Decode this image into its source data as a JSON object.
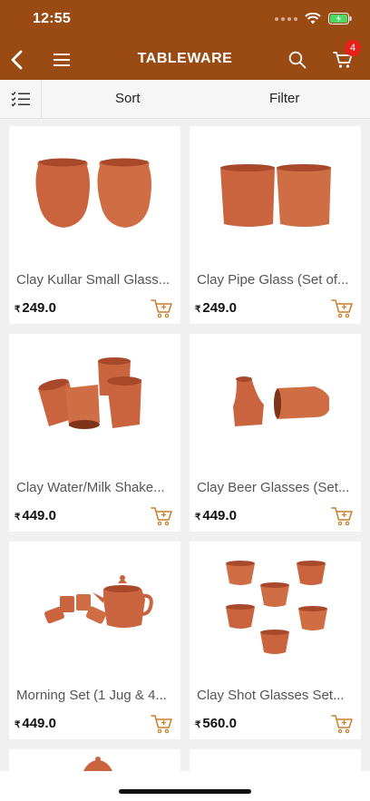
{
  "status_bar": {
    "time": "12:55"
  },
  "header": {
    "title": "TABLEWARE",
    "cart_count": "4"
  },
  "toolbar": {
    "sort_label": "Sort",
    "filter_label": "Filter"
  },
  "currency_symbol": "₹",
  "products": [
    {
      "name": "Clay Kullar Small Glass...",
      "price": "249.0"
    },
    {
      "name": "Clay Pipe Glass (Set of...",
      "price": "249.0"
    },
    {
      "name": "Clay Water/Milk Shake...",
      "price": "449.0"
    },
    {
      "name": "Clay Beer Glasses (Set...",
      "price": "449.0"
    },
    {
      "name": "Morning Set (1 Jug & 4...",
      "price": "449.0"
    },
    {
      "name": "Clay Shot Glasses Set...",
      "price": "560.0"
    }
  ],
  "colors": {
    "header_bg": "#9a4a13",
    "accent": "#c87f2a",
    "clay": "#c9643e",
    "badge": "#e8221b"
  }
}
